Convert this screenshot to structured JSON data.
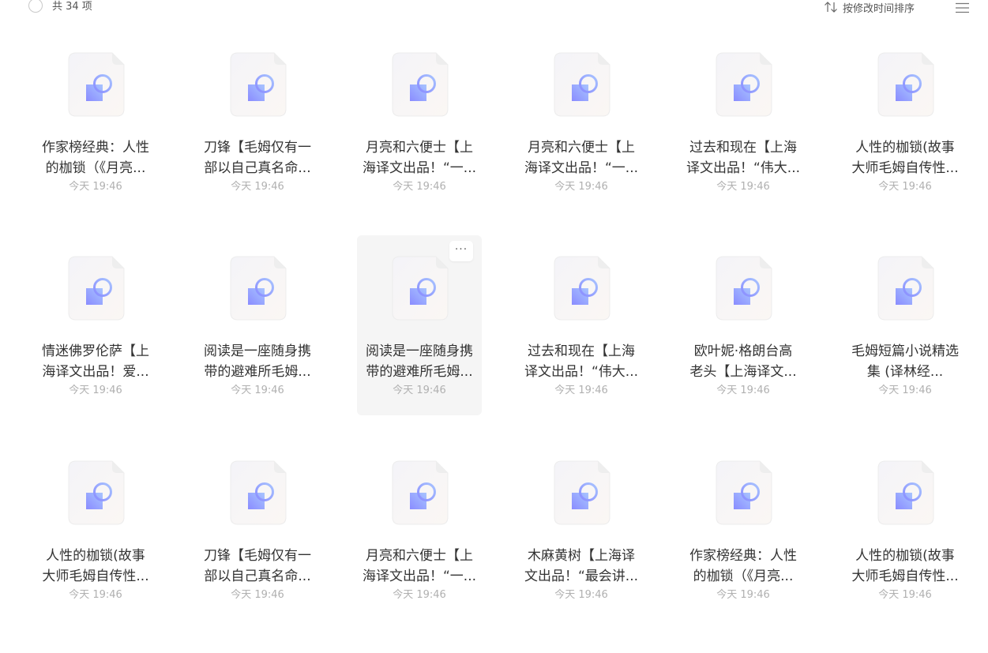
{
  "header": {
    "count_label": "共 34 项",
    "sort_label": "按修改时间排序",
    "sort_icon": "sort-arrows-icon",
    "menu_icon": "list-menu-icon"
  },
  "colors": {
    "icon_gradient_start": "#8a8cff",
    "icon_gradient_end": "#a8c4ff",
    "doc_bg": "#f7f6f7",
    "hover_bg": "#f5f5f5"
  },
  "files": [
    {
      "line1": "作家榜经典：人性",
      "line2": "的枷锁（《月亮...",
      "date": "今天 19:46"
    },
    {
      "line1": "刀锋【毛姆仅有一",
      "line2": "部以自己真名命...",
      "date": "今天 19:46"
    },
    {
      "line1": "月亮和六便士【上",
      "line2": "海译文出品！“一...",
      "date": "今天 19:46"
    },
    {
      "line1": "月亮和六便士【上",
      "line2": "海译文出品！“一...",
      "date": "今天 19:46"
    },
    {
      "line1": "过去和现在【上海",
      "line2": "译文出品！“伟大...",
      "date": "今天 19:46"
    },
    {
      "line1": "人性的枷锁(故事",
      "line2": "大师毛姆自传性...",
      "date": "今天 19:46"
    },
    {
      "line1": "情迷佛罗伦萨【上",
      "line2": "海译文出品！爱...",
      "date": "今天 19:46"
    },
    {
      "line1": "阅读是一座随身携",
      "line2": "带的避难所毛姆...",
      "date": "今天 19:46"
    },
    {
      "line1": "阅读是一座随身携",
      "line2": "带的避难所毛姆...",
      "date": "今天 19:46",
      "more": "···"
    },
    {
      "line1": "过去和现在【上海",
      "line2": "译文出品！“伟大...",
      "date": "今天 19:46"
    },
    {
      "line1": "欧叶妮·格朗台高",
      "line2": "老头【上海译文...",
      "date": "今天 19:46"
    },
    {
      "line1": "毛姆短篇小说精选",
      "line2": "集 (译林经...",
      "date": "今天 19:46"
    },
    {
      "line1": "人性的枷锁(故事",
      "line2": "大师毛姆自传性...",
      "date": "今天 19:46"
    },
    {
      "line1": "刀锋【毛姆仅有一",
      "line2": "部以自己真名命...",
      "date": "今天 19:46"
    },
    {
      "line1": "月亮和六便士【上",
      "line2": "海译文出品！“一...",
      "date": "今天 19:46"
    },
    {
      "line1": "木麻黄树【上海译",
      "line2": "文出品！“最会讲...",
      "date": "今天 19:46"
    },
    {
      "line1": "作家榜经典：人性",
      "line2": "的枷锁（《月亮...",
      "date": "今天 19:46"
    },
    {
      "line1": "人性的枷锁(故事",
      "line2": "大师毛姆自传性...",
      "date": "今天 19:46"
    }
  ]
}
